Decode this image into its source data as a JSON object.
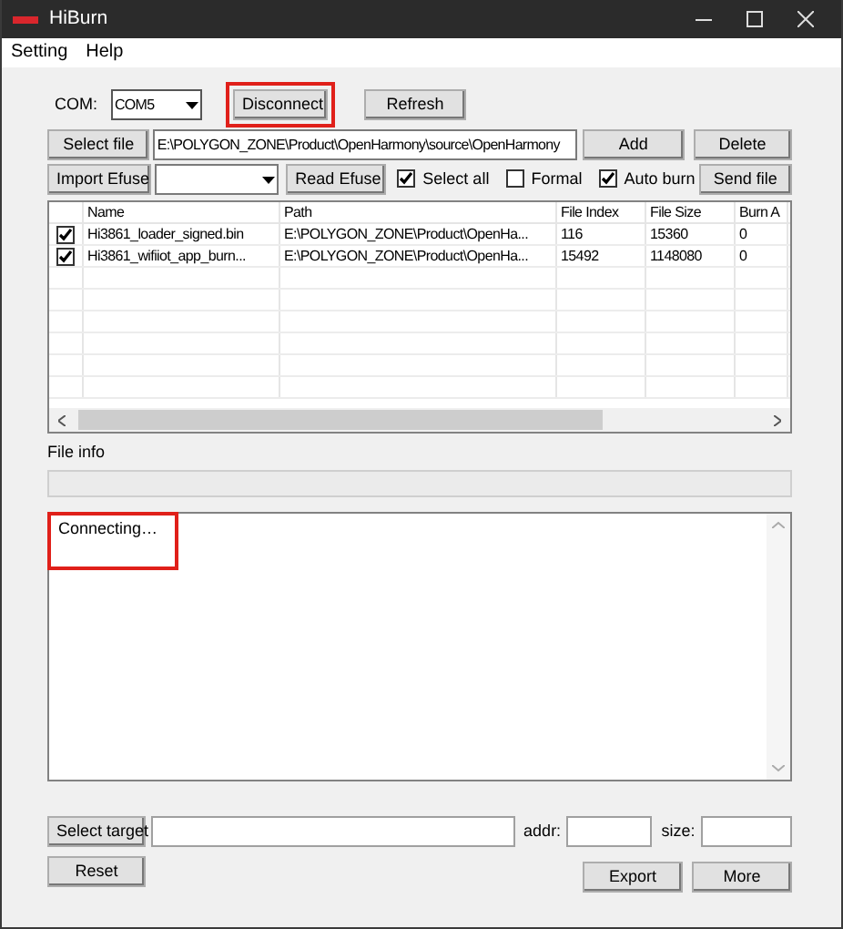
{
  "window": {
    "title": "HiBurn"
  },
  "menu": [
    "Setting",
    "Help"
  ],
  "com": {
    "label": "COM:",
    "value": "COM5"
  },
  "connect_buttons": [
    {
      "label": "Disconnect",
      "highlighted": true
    },
    {
      "label": "Refresh",
      "highlighted": false
    }
  ],
  "file_row": {
    "button": "Select file",
    "path": "E:\\POLYGON_ZONE\\Product\\OpenHarmony\\source\\OpenHarmony",
    "add": "Add",
    "delete": "Delete"
  },
  "efuse_row": {
    "button": "Import Efuse",
    "read": "Read Efuse",
    "send": "Send file",
    "checks": [
      {
        "label": "Select all",
        "checked": true
      },
      {
        "label": "Formal",
        "checked": false
      },
      {
        "label": "Auto burn",
        "checked": true
      }
    ]
  },
  "table": {
    "columns": [
      "Name",
      "Path",
      "File Index",
      "File Size",
      "Burn A"
    ],
    "rows": [
      {
        "checked": true,
        "cells": [
          "Hi3861_loader_signed.bin",
          "E:\\POLYGON_ZONE\\Product\\OpenHa...",
          "116",
          "15360",
          "0"
        ]
      },
      {
        "checked": true,
        "cells": [
          "Hi3861_wifiiot_app_burn...",
          "E:\\POLYGON_ZONE\\Product\\OpenHa...",
          "15492",
          "1148080",
          "0"
        ]
      }
    ]
  },
  "file_info": {
    "label": "File info"
  },
  "log": {
    "text": "Connecting…",
    "highlighted": true
  },
  "target_row": {
    "button": "Select target",
    "addr_label": "addr:",
    "size_label": "size:"
  },
  "bottom_buttons": [
    {
      "label": "Reset"
    },
    {
      "label": "Export"
    },
    {
      "label": "More"
    }
  ]
}
